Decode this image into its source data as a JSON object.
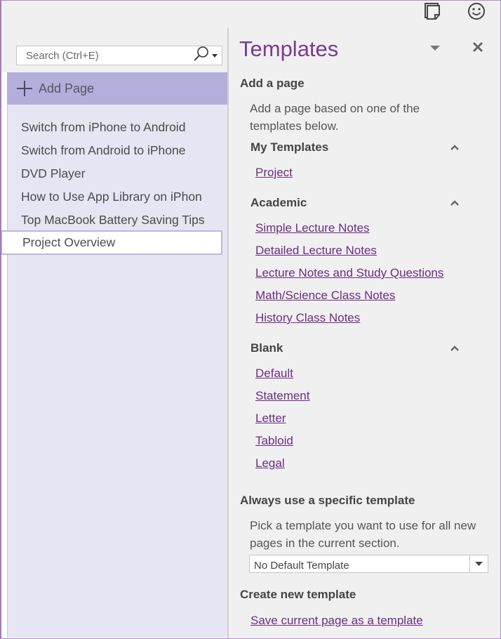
{
  "top_icons": {
    "sticky_note": "sticky-note-icon",
    "feedback": "smiley-icon"
  },
  "left_pane": {
    "search": {
      "placeholder": "Search (Ctrl+E)",
      "value": ""
    },
    "add_page_label": "Add Page",
    "pages": [
      {
        "title": "Switch from iPhone to Android",
        "selected": false
      },
      {
        "title": "Switch from Android to iPhone",
        "selected": false
      },
      {
        "title": "DVD Player",
        "selected": false
      },
      {
        "title": "How to Use App Library on iPhon",
        "selected": false
      },
      {
        "title": "Top MacBook Battery Saving Tips",
        "selected": false
      },
      {
        "title": "Project Overview",
        "selected": true
      }
    ]
  },
  "templates_pane": {
    "title": "Templates",
    "add_a_page": {
      "heading": "Add a page",
      "description_line1": "Add a page based on one of the",
      "description_line2": "templates below."
    },
    "groups": [
      {
        "name": "My Templates",
        "expanded": true,
        "items": [
          "Project"
        ]
      },
      {
        "name": "Academic",
        "expanded": true,
        "items": [
          "Simple Lecture Notes",
          "Detailed Lecture Notes",
          "Lecture Notes and Study Questions",
          "Math/Science Class Notes",
          "History Class Notes"
        ]
      },
      {
        "name": "Blank",
        "expanded": true,
        "items": [
          "Default",
          "Statement",
          "Letter",
          "Tabloid",
          "Legal"
        ]
      }
    ],
    "always_use": {
      "heading": "Always use a specific template",
      "description_line1": "Pick a template you want to use for all new",
      "description_line2": "pages in the current section.",
      "selected_value": "No Default Template"
    },
    "create_new": {
      "heading": "Create new template",
      "link": "Save current page as a template"
    }
  },
  "colors": {
    "accent_purple": "#7a3b8f",
    "link_purple": "#6b2d82",
    "add_page_bg": "#b4aedc",
    "page_list_bg": "#e6e5f4"
  }
}
